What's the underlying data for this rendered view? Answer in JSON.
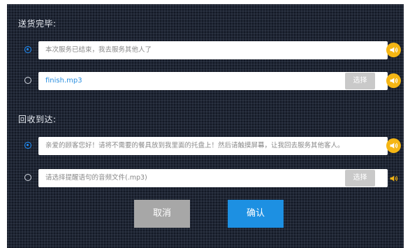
{
  "sections": [
    {
      "title": "送货完毕:",
      "text_option": {
        "selected": true,
        "value": "本次服务已结束，我去服务其他人了"
      },
      "file_option": {
        "selected": false,
        "value": "finish.mp3",
        "placeholder": "",
        "pick_label": "选择"
      }
    },
    {
      "title": "回收到达:",
      "text_option": {
        "selected": true,
        "value": "亲爱的顾客您好！请将不需要的餐具放到我里面的托盘上！然后请触摸屏幕，让我回去服务其他客人。"
      },
      "file_option": {
        "selected": false,
        "value": "",
        "placeholder": "请选择提醒语句的音频文件(.mp3)",
        "pick_label": "选择"
      }
    }
  ],
  "buttons": {
    "cancel_label": "取消",
    "confirm_label": "确认"
  },
  "icons": {
    "speaker": "speaker-icon"
  },
  "colors": {
    "background": "#1f2636",
    "accent": "#1d90e2",
    "speaker": "#f5b614",
    "cancel": "#a7a7a7",
    "pick": "#c9c9c9"
  }
}
